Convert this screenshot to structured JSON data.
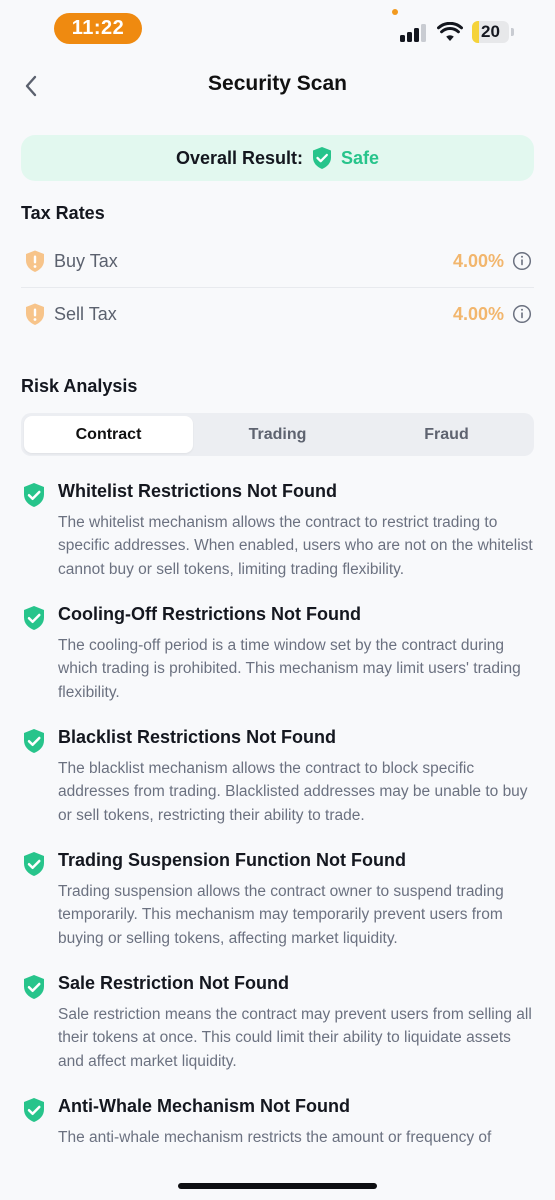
{
  "status_bar": {
    "time": "11:22",
    "battery": "20",
    "battery_level": 0.2
  },
  "header": {
    "title": "Security Scan",
    "back_icon": "chevron-left-icon"
  },
  "overall": {
    "label": "Overall Result:",
    "value": "Safe",
    "icon": "shield-check-icon",
    "color": "#27c48b"
  },
  "tax_rates": {
    "title": "Tax Rates",
    "items": [
      {
        "label": "Buy Tax",
        "value": "4.00%"
      },
      {
        "label": "Sell Tax",
        "value": "4.00%"
      }
    ],
    "warning_color": "#f2b66d"
  },
  "risk_analysis": {
    "title": "Risk Analysis",
    "tabs": [
      {
        "label": "Contract",
        "active": true
      },
      {
        "label": "Trading",
        "active": false
      },
      {
        "label": "Fraud",
        "active": false
      }
    ],
    "items": [
      {
        "title": "Whitelist Restrictions Not Found",
        "description": "The whitelist mechanism allows the contract to restrict trading to specific addresses. When enabled, users who are not on the whitelist cannot buy or sell tokens, limiting trading flexibility."
      },
      {
        "title": "Cooling-Off Restrictions Not Found",
        "description": "The cooling-off period is a time window set by the contract during which trading is prohibited. This mechanism may limit users' trading flexibility."
      },
      {
        "title": "Blacklist Restrictions Not Found",
        "description": "The blacklist mechanism allows the contract to block specific addresses from trading. Blacklisted addresses may be unable to buy or sell tokens, restricting their ability to trade."
      },
      {
        "title": "Trading Suspension Function Not Found",
        "description": "Trading suspension allows the contract owner to suspend trading temporarily. This mechanism may temporarily prevent users from buying or selling tokens, affecting market liquidity."
      },
      {
        "title": "Sale Restriction Not Found",
        "description": "Sale restriction means the contract may prevent users from selling all their tokens at once. This could limit their ability to liquidate assets and affect market liquidity."
      },
      {
        "title": "Anti-Whale Mechanism Not Found",
        "description": "The anti-whale mechanism restricts the amount or frequency of"
      }
    ]
  }
}
